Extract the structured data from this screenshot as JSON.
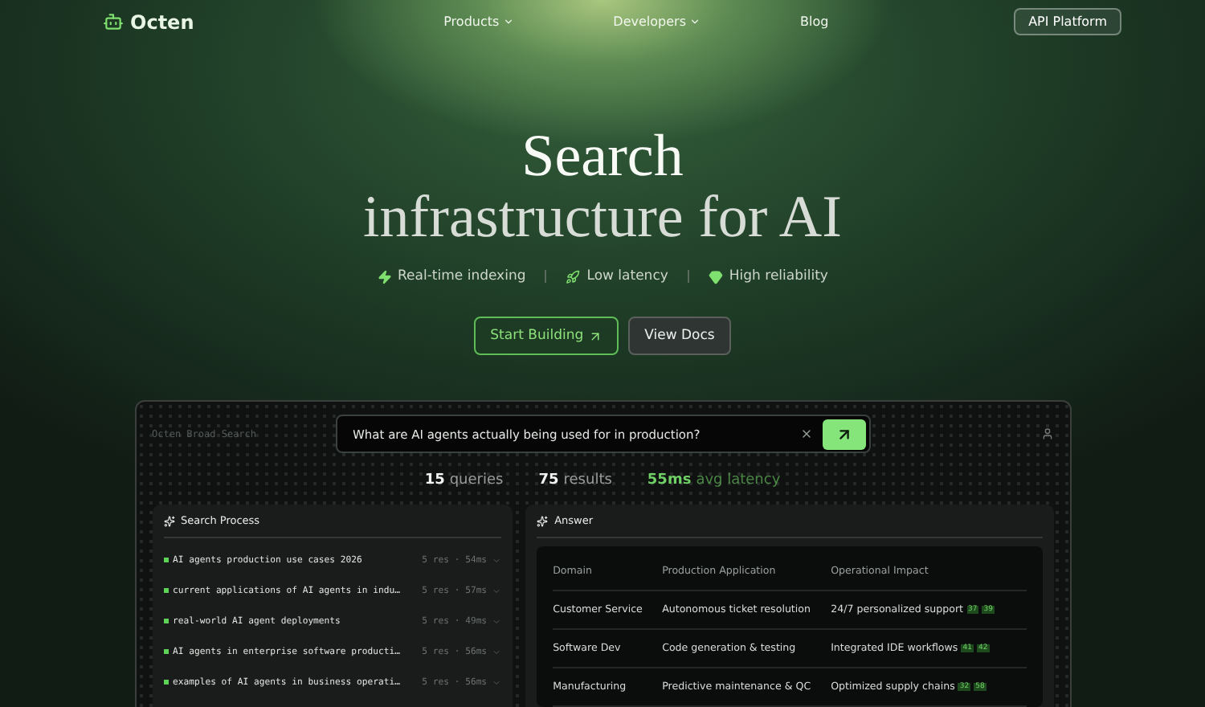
{
  "nav": {
    "logo": "Octen",
    "links": [
      {
        "label": "Products",
        "dropdown": true
      },
      {
        "label": "Developers",
        "dropdown": true
      },
      {
        "label": "Blog",
        "dropdown": false
      }
    ],
    "cta": "API Platform"
  },
  "hero": {
    "title_line_1": "Search",
    "title_line_2": "infrastructure for AI",
    "features": [
      {
        "kind": "bolt",
        "label": "Real-time indexing"
      },
      {
        "kind": "rocket",
        "label": "Low latency"
      },
      {
        "kind": "gem",
        "label": "High reliability"
      }
    ],
    "buttons": [
      {
        "kind": "primary",
        "label": "Start Building"
      },
      {
        "kind": "secondary",
        "label": "View Docs"
      }
    ]
  },
  "demo": {
    "app_label": "Octen Broad Search",
    "query": "What are AI agents actually being used for in production?",
    "stats": [
      {
        "value": "15",
        "label": "queries",
        "highlight": false
      },
      {
        "value": "75",
        "label": "results",
        "highlight": false
      },
      {
        "value": "55ms",
        "label": "avg latency",
        "highlight": true
      }
    ],
    "search_process": {
      "title": "Search Process",
      "separator": "·",
      "rows": [
        {
          "query": "AI agents production use cases 2026",
          "results": "5 res",
          "time": "54ms"
        },
        {
          "query": "current applications of AI agents in indu…",
          "results": "5 res",
          "time": "57ms"
        },
        {
          "query": "real-world AI agent deployments",
          "results": "5 res",
          "time": "49ms"
        },
        {
          "query": "AI agents in enterprise software producti…",
          "results": "5 res",
          "time": "56ms"
        },
        {
          "query": "examples of AI agents in business operati…",
          "results": "5 res",
          "time": "56ms"
        }
      ]
    },
    "answer": {
      "title": "Answer",
      "columns": [
        "Domain",
        "Production Application",
        "Operational Impact"
      ],
      "rows": [
        {
          "domain": "Customer Service",
          "application": "Autonomous ticket resolution",
          "impact": "24/7 personalized support",
          "citations": [
            "37",
            "39"
          ]
        },
        {
          "domain": "Software Dev",
          "application": "Code generation & testing",
          "impact": "Integrated IDE workflows",
          "citations": [
            "41",
            "42"
          ]
        },
        {
          "domain": "Manufacturing",
          "application": "Predictive maintenance & QC",
          "impact": "Optimized supply chains",
          "citations": [
            "32",
            "58"
          ]
        }
      ]
    }
  }
}
